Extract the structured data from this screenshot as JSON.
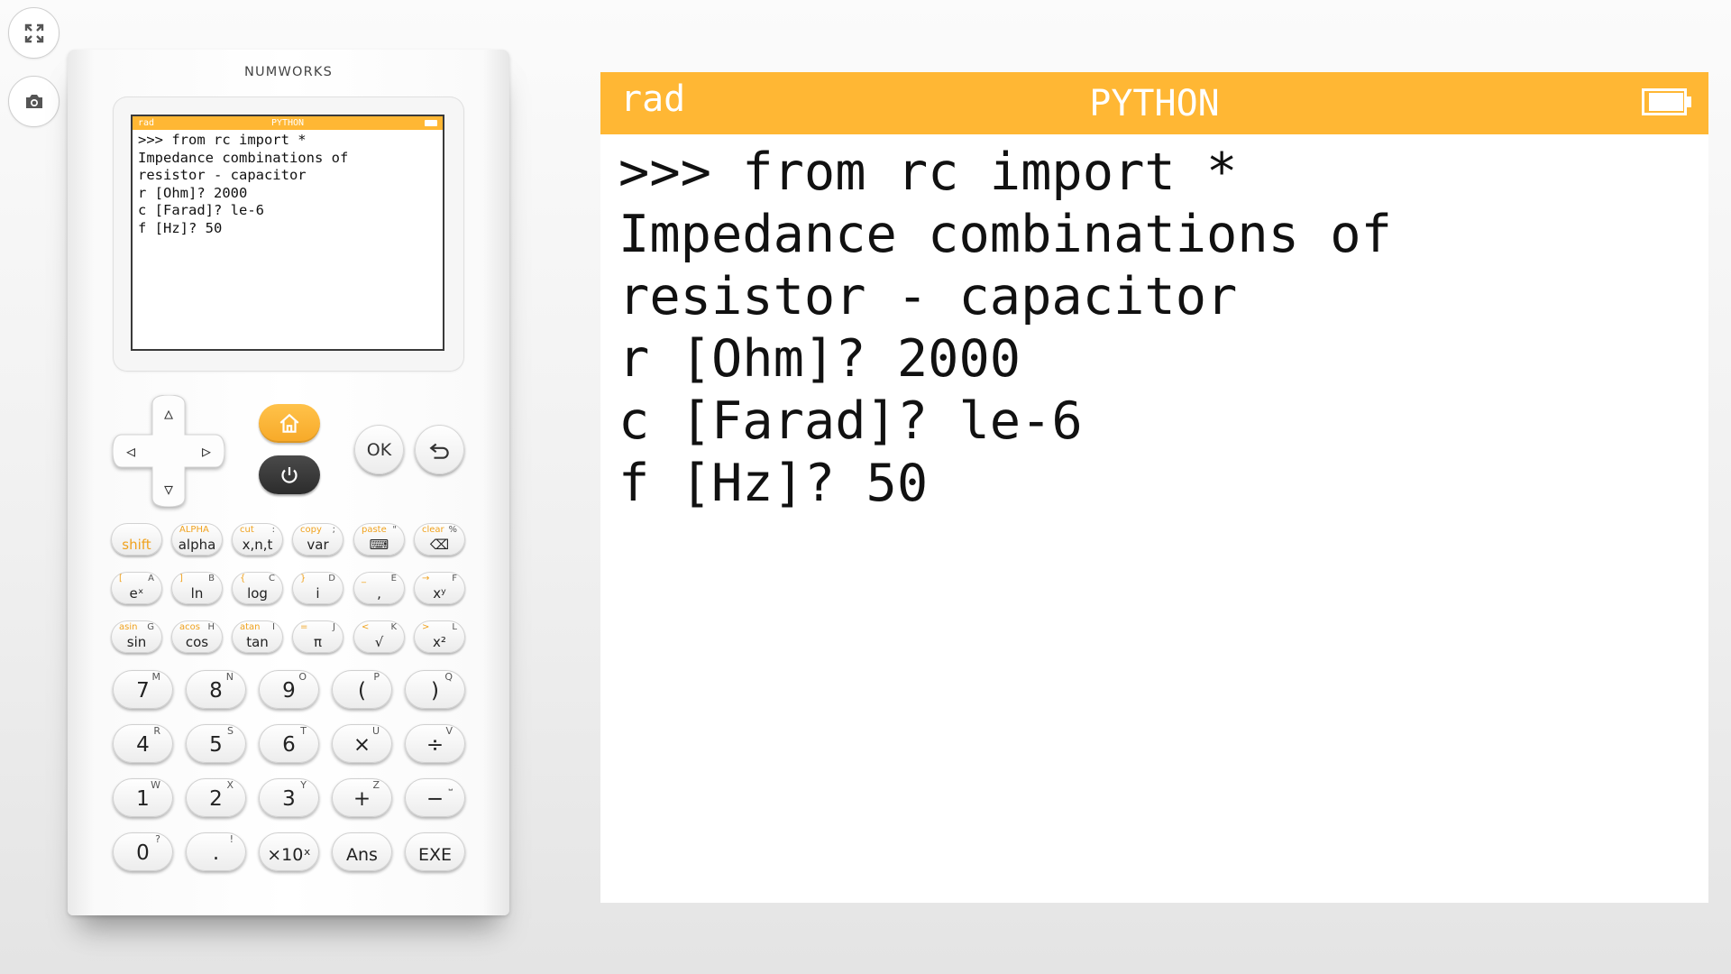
{
  "toolbar": {
    "fullscreen_icon": "fullscreen-icon",
    "screenshot_icon": "camera-icon"
  },
  "calculator": {
    "brand": "NUMWORKS",
    "mini_screen": {
      "angle": "rad",
      "title": "PYTHON",
      "lines": [
        ">>> from rc import *",
        "Impedance combinations of",
        "resistor - capacitor",
        "r [Ohm]? 2000",
        "c [Farad]? le-6",
        "f [Hz]? 50"
      ]
    },
    "nav": {
      "up": "▵",
      "down": "▿",
      "left": "◃",
      "right": "▹",
      "home_icon": "home-icon",
      "power_icon": "power-icon",
      "ok": "OK",
      "back_icon": "back-arrow-icon"
    },
    "function_rows": [
      [
        {
          "main": "shift",
          "sub1": "",
          "sub2": "",
          "main_orange": true
        },
        {
          "main": "alpha",
          "sub1": "ALPHA",
          "sub2": ""
        },
        {
          "main": "x,n,t",
          "sub1": "cut",
          "sub2": ":"
        },
        {
          "main": "var",
          "sub1": "copy",
          "sub2": ";"
        },
        {
          "main": "⌨",
          "sub1": "paste",
          "sub2": "\""
        },
        {
          "main": "⌫",
          "sub1": "clear",
          "sub2": "%"
        }
      ],
      [
        {
          "main": "eˣ",
          "sub1": "[",
          "sub2": "A"
        },
        {
          "main": "ln",
          "sub1": "]",
          "sub2": "B"
        },
        {
          "main": "log",
          "sub1": "{",
          "sub2": "C"
        },
        {
          "main": "i",
          "sub1": "}",
          "sub2": "D"
        },
        {
          "main": ",",
          "sub1": "_",
          "sub2": "E"
        },
        {
          "main": "xʸ",
          "sub1": "→",
          "sub2": "F"
        }
      ],
      [
        {
          "main": "sin",
          "sub1": "asin",
          "sub2": "G"
        },
        {
          "main": "cos",
          "sub1": "acos",
          "sub2": "H"
        },
        {
          "main": "tan",
          "sub1": "atan",
          "sub2": "I"
        },
        {
          "main": "π",
          "sub1": "=",
          "sub2": "J"
        },
        {
          "main": "√",
          "sub1": "<",
          "sub2": "K"
        },
        {
          "main": "x²",
          "sub1": ">",
          "sub2": "L"
        }
      ]
    ],
    "number_rows": [
      [
        {
          "main": "7",
          "sub": "M"
        },
        {
          "main": "8",
          "sub": "N"
        },
        {
          "main": "9",
          "sub": "O"
        },
        {
          "main": "(",
          "sub": "P"
        },
        {
          "main": ")",
          "sub": "Q"
        }
      ],
      [
        {
          "main": "4",
          "sub": "R"
        },
        {
          "main": "5",
          "sub": "S"
        },
        {
          "main": "6",
          "sub": "T"
        },
        {
          "main": "×",
          "sub": "U"
        },
        {
          "main": "÷",
          "sub": "V"
        }
      ],
      [
        {
          "main": "1",
          "sub": "W"
        },
        {
          "main": "2",
          "sub": "X"
        },
        {
          "main": "3",
          "sub": "Y"
        },
        {
          "main": "+",
          "sub": "Z"
        },
        {
          "main": "−",
          "sub": "⎵"
        }
      ],
      [
        {
          "main": "0",
          "sub": "?"
        },
        {
          "main": ".",
          "sub": "!"
        },
        {
          "main": "×10ˣ",
          "sub": ""
        },
        {
          "main": "Ans",
          "sub": ""
        },
        {
          "main": "EXE",
          "sub": ""
        }
      ]
    ]
  },
  "screen": {
    "angle": "rad",
    "title": "PYTHON",
    "battery_icon": "battery-icon",
    "lines": [
      ">>> from rc import *",
      "Impedance combinations of",
      "resistor - capacitor",
      "r [Ohm]? 2000",
      "c [Farad]? le-6",
      "f [Hz]? 50"
    ]
  },
  "colors": {
    "accent": "#ffb734",
    "power_key": "#2f2f2f",
    "background": "#f2f2f2"
  }
}
